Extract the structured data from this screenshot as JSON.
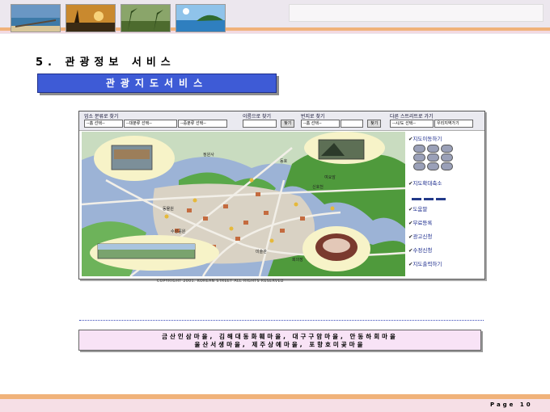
{
  "slide": {
    "section_title": "5. 관광정보 서비스",
    "subtitle": "관광지도서비스",
    "villages_line1": "금산인삼마을, 김해대동화훼마을, 대구구암마을, 안동하회마을",
    "villages_line2": "울산서생마을, 제주상예마을, 포항호미곶마을",
    "page_label": "Page 10"
  },
  "map": {
    "toolbar": {
      "group1_title": "업소 분류로 찾기",
      "group1_select1": "--홈 선택--",
      "group1_select2": "--대분류 선택--",
      "group1_select3": "--중분류 선택--",
      "group2_title": "이름으로 찾기",
      "group2_button": "찾기",
      "group3_title": "번지로 찾기",
      "group3_select": "--홈 선택--",
      "group3_button": "찾기",
      "group4_title": "다른 스트리트로 가기",
      "group4_select1": "--시/도 선택--",
      "group4_select2": "우리지역가기"
    },
    "sidebar": {
      "nav_label": "지도이동하기",
      "zoom_label": "지도확대축소",
      "items": [
        "도움말",
        "무료등록",
        "광고신청",
        "수정신청",
        "지도출력하기"
      ]
    },
    "copyright": "COPYRIGHT 2001. KOREAN STREET ALL RIGHTS RESERVED",
    "place_labels": [
      "정원사",
      "동호",
      "여요암",
      "신호천",
      "동물원",
      "수성공원",
      "미술관",
      "회의장"
    ]
  },
  "colors": {
    "banner_blue": "#3e5bd6",
    "village_box_pink": "#f8e3f6",
    "stripe_orange": "#f0b27a",
    "map_water": "#8fa9cd",
    "map_green": "#4f9a3c"
  }
}
